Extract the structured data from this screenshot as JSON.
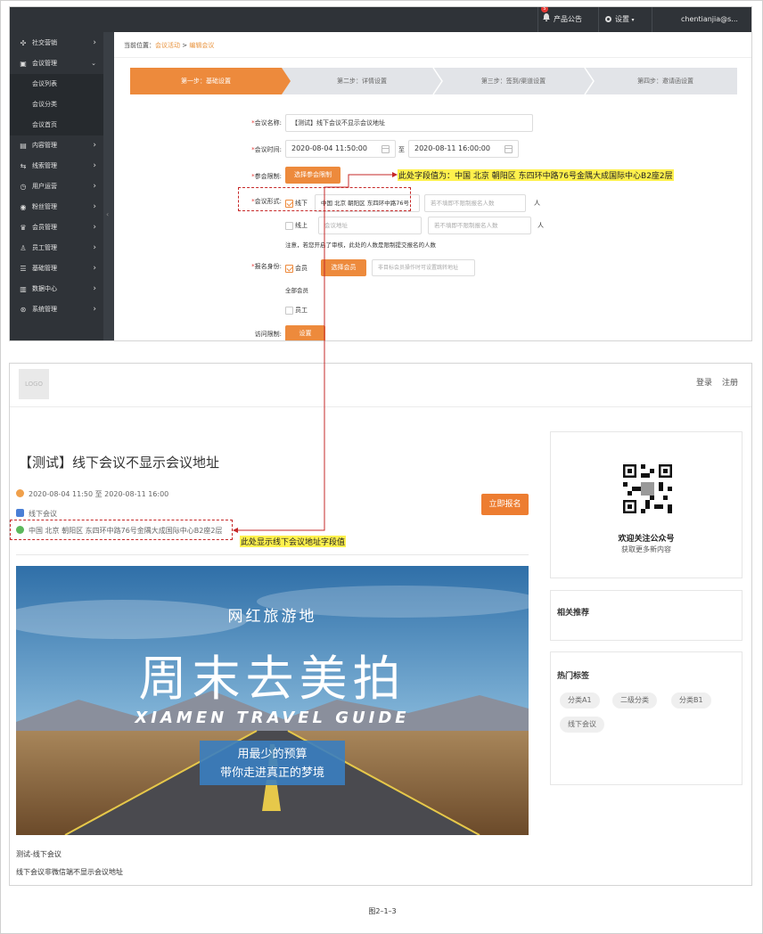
{
  "admin": {
    "topbar": {
      "notification_badge": "5",
      "announcement": "产品公告",
      "settings": "设置",
      "user": "chentianjia@s...",
      "collapse_arrow": "◂"
    },
    "sidebar": {
      "items": [
        {
          "icon": "share-icon",
          "label": "社交营销",
          "expanded": false
        },
        {
          "icon": "meeting-icon",
          "label": "会议管理",
          "expanded": true
        },
        {
          "icon": "content-icon",
          "label": "内容管理",
          "expanded": false
        },
        {
          "icon": "lead-icon",
          "label": "线索管理",
          "expanded": false
        },
        {
          "icon": "user-ops-icon",
          "label": "用户运营",
          "expanded": false
        },
        {
          "icon": "fans-icon",
          "label": "粉丝管理",
          "expanded": false
        },
        {
          "icon": "member-icon",
          "label": "会员管理",
          "expanded": false
        },
        {
          "icon": "staff-icon",
          "label": "员工管理",
          "expanded": false
        },
        {
          "icon": "basic-icon",
          "label": "基础管理",
          "expanded": false
        },
        {
          "icon": "data-icon",
          "label": "数据中心",
          "expanded": false
        },
        {
          "icon": "system-icon",
          "label": "系统管理",
          "expanded": false
        }
      ],
      "sub_items": [
        "会议列表",
        "会议分类",
        "会议首页"
      ]
    },
    "breadcrumb": {
      "prefix": "当前位置：",
      "link": "会议活动",
      "sep": ">",
      "current": "编辑会议"
    },
    "steps": [
      "第一步：基础设置",
      "第二步：详情设置",
      "第三步：签到/渠道设置",
      "第四步：邀请函设置"
    ],
    "form": {
      "name_label": "会议名称:",
      "name_value": "【测试】线下会议不显示会议地址",
      "time_label": "会议时间:",
      "time_start": "2020-08-04 11:50:00",
      "time_to": "至",
      "time_end": "2020-08-11 16:00:00",
      "limit_label": "参会限制:",
      "limit_button": "选择参会限制",
      "format_label": "会议形式:",
      "offline_label": "线下",
      "offline_address": "中国 北京 朝阳区 东四环中路76号",
      "offline_limit_placeholder": "若不填即不限制报名人数",
      "unit": "人",
      "online_label": "线上",
      "online_address_placeholder": "会议地址",
      "online_limit_placeholder": "若不填即不限制报名人数",
      "note": "注意，若您开启了审核，此处的人数是限制提交报名的人数",
      "identity_label": "报名身份:",
      "member_label": "会员",
      "member_button": "选择会员",
      "member_placeholder": "非目标会员操作时可设置跳转地址",
      "all_members": "全部会员",
      "staff_label": "员工",
      "access_label": "访问限制:",
      "access_button": "设置"
    }
  },
  "front": {
    "logo": "LOGO",
    "nav": {
      "login": "登录",
      "register": "注册"
    },
    "title": "【测试】线下会议不显示会议地址",
    "time": "2020-08-04 11:50 至 2020-08-11 16:00",
    "format": "线下会议",
    "address": "中国 北京 朝阳区 东四环中路76号金隅大成国际中心B2座2层",
    "register_button": "立即报名",
    "banner": {
      "line1": "网红旅游地",
      "line2": "周末去美拍",
      "line3": "XIAMEN TRAVEL GUIDE",
      "line4": "用最少的预算",
      "line5": "带你走进真正的梦境"
    },
    "desc_title": "测试-线下会议",
    "desc_body": "线下会议非微信端不显示会议地址",
    "qr_card": {
      "title": "欢迎关注公众号",
      "subtitle": "获取更多新内容"
    },
    "related_title": "相关推荐",
    "tags_title": "热门标签",
    "tags": [
      "分类A1",
      "二级分类",
      "分类B1",
      "线下会议"
    ]
  },
  "annotations": {
    "admin_note": "此处字段值为：中国 北京 朝阳区 东四环中路76号金隅大成国际中心B2座2层",
    "front_note": "此处显示线下会议地址字段值"
  },
  "caption": "图2–1–3"
}
